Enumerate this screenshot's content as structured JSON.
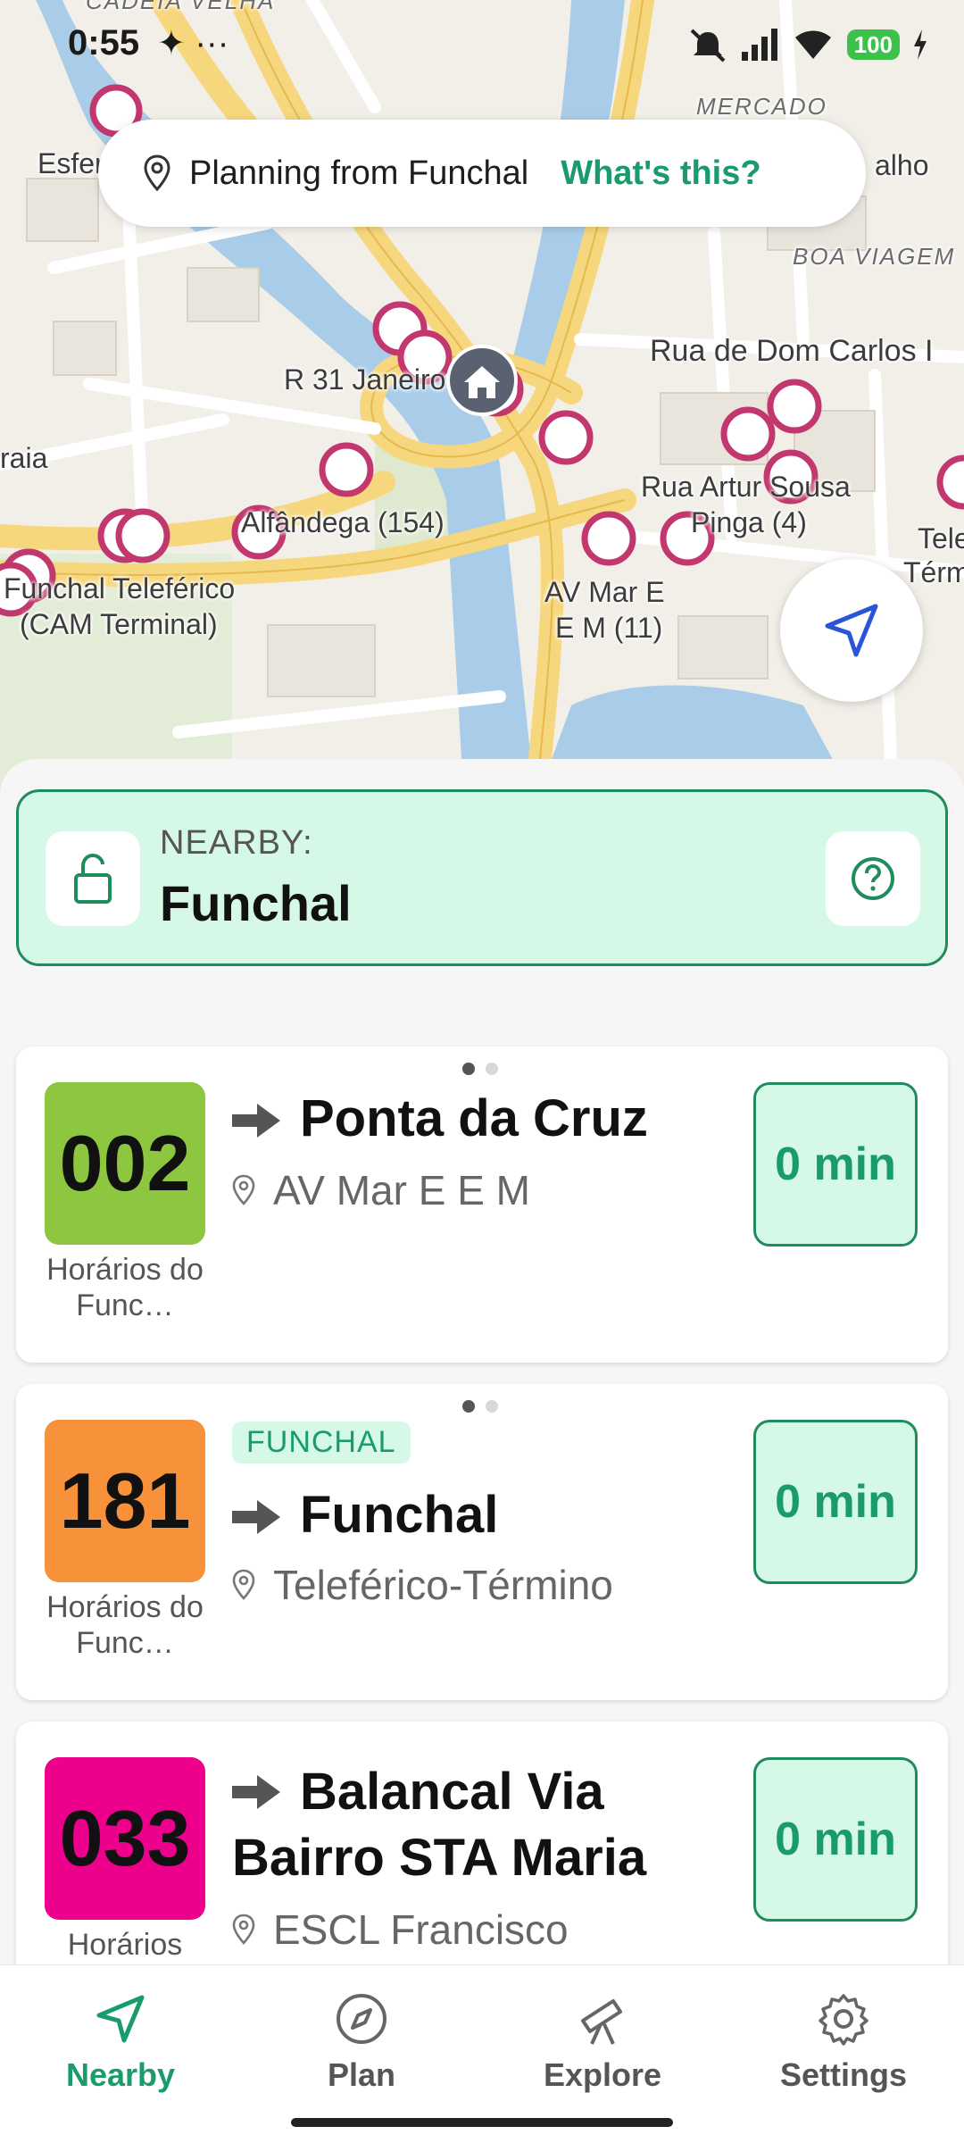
{
  "status_bar": {
    "time": "0:55",
    "extra": "✦ ···",
    "battery": "100"
  },
  "map": {
    "planning_text": "Planning from Funchal",
    "whats_this": "What's this?",
    "labels": {
      "esfera": "Esfer",
      "mercado": "MERCADO",
      "alho": "alho",
      "boa_viagem": "BOA VIAGEM",
      "rua_dom_carlos": "Rua de Dom Carlos I",
      "r31": "R 31 Janeiro",
      "praia": "raia",
      "rua_artur": "Rua Artur Sousa",
      "pinga": "Pinga (4)",
      "alfandega": "Alfândega (154)",
      "funchal_tele": "Funchal Teleférico",
      "cam_terminal": "(CAM Terminal)",
      "av_mar": "AV Mar  E",
      "em11": "E M (11)",
      "tele": "Tele",
      "term": "Térm",
      "cadeia": "CADEIA VELHA"
    }
  },
  "nearby": {
    "label": "NEARBY:",
    "place": "Funchal"
  },
  "routes": [
    {
      "number": "002",
      "color": "#8dc63f",
      "agency": "Horários do Func…",
      "agency_tag": "",
      "destination": "Ponta da Cruz",
      "stop": "AV Mar  E E M",
      "eta": "0 min"
    },
    {
      "number": "181",
      "color": "#f7923a",
      "agency": "Horários do Func…",
      "agency_tag": "FUNCHAL",
      "destination": "Funchal",
      "stop": "Teleférico-Término",
      "eta": "0 min"
    },
    {
      "number": "033",
      "color": "#ec008c",
      "agency": "Horários",
      "agency_tag": "",
      "destination": "Balancal Via Bairro STA Maria",
      "stop": "ESCL Francisco",
      "eta": "0 min"
    }
  ],
  "nav": {
    "nearby": "Nearby",
    "plan": "Plan",
    "explore": "Explore",
    "settings": "Settings"
  },
  "colors": {
    "accent": "#1a9b6b",
    "accent_bg": "#d6f8e6",
    "stop_marker": "#c2386e"
  }
}
